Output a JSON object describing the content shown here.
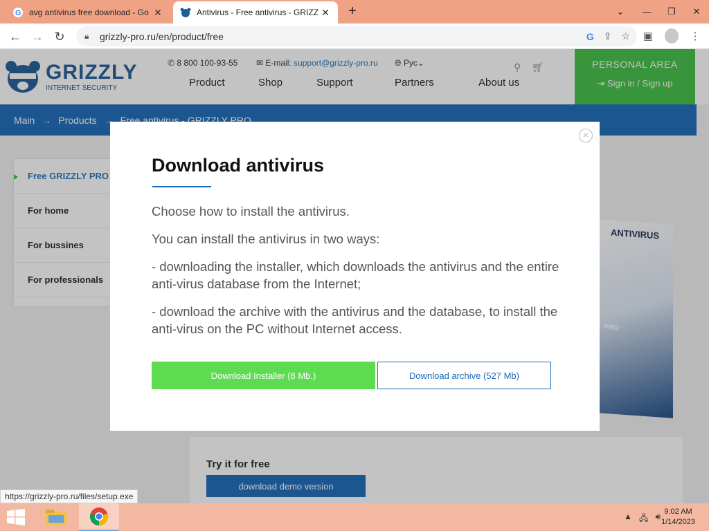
{
  "browser": {
    "tabs": [
      {
        "title": "avg antivirus free download - Go",
        "favicon": "google-icon",
        "active": false
      },
      {
        "title": "Antivirus - Free antivirus - GRIZZ",
        "favicon": "grizzly-icon",
        "active": true
      }
    ],
    "url": "grizzly-pro.ru/en/product/free"
  },
  "site": {
    "logo": {
      "name": "GRIZZLY",
      "tagline": "INTERNET SECURITY"
    },
    "phone": "8 800 100-93-55",
    "email_label": "E-mail:",
    "email": "support@grizzly-pro.ru",
    "language": "Рус",
    "nav": [
      "Product",
      "Shop",
      "Support",
      "Partners",
      "About us"
    ],
    "personal_area": {
      "title": "PERSONAL AREA",
      "signin": "Sign in / Sign up"
    },
    "breadcrumbs": [
      "Main",
      "Products",
      "Free antivirus - GRIZZLY PRO"
    ],
    "side_menu": [
      "Free GRIZZLY PRO",
      "For home",
      "For bussines",
      "For professionals"
    ],
    "product_box_label": "ANTIVIRUS",
    "product_box_sub": "PRO",
    "try": {
      "title": "Try it for free",
      "button": "download demo version"
    }
  },
  "modal": {
    "title": "Download antivirus",
    "paragraphs": [
      "Choose how to install the antivirus.",
      "You can install the antivirus in two ways:",
      "- downloading the installer, which downloads the antivirus and the entire anti-virus database from the Internet;",
      "- download the archive with the antivirus and the database, to install the anti-virus on the PC without Internet access."
    ],
    "btn_installer": "Download Installer (8 Mb.)",
    "btn_archive": "Download archive (527 Mb)"
  },
  "status_url": "https://grizzly-pro.ru/files/setup.exe",
  "clock": {
    "time": "9:02 AM",
    "date": "1/14/2023"
  },
  "colors": {
    "brand_blue": "#1769b9",
    "green": "#3fbf45",
    "button_green": "#5ddc52",
    "tab_bar": "#f0a384"
  }
}
